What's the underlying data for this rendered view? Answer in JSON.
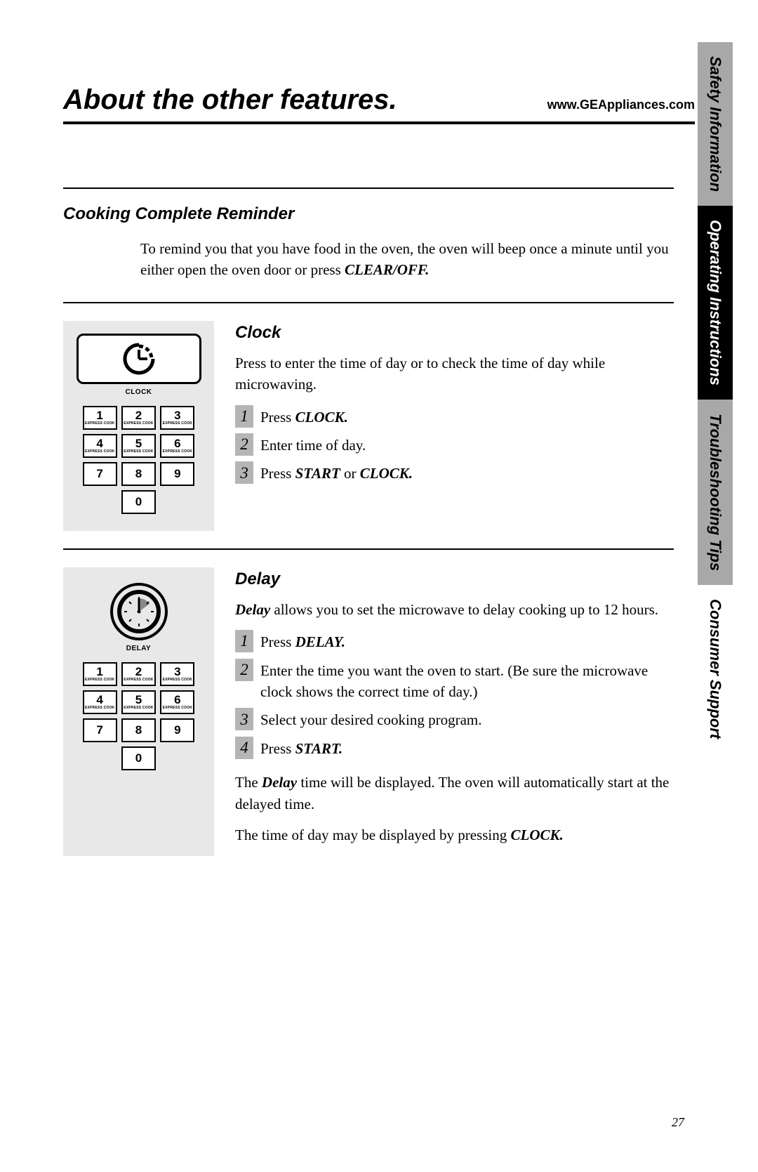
{
  "header": {
    "title": "About the other features.",
    "url": "www.GEAppliances.com"
  },
  "tabs": {
    "safety": "Safety Information",
    "operating": "Operating Instructions",
    "troubleshooting": "Troubleshooting Tips",
    "consumer": "Consumer Support"
  },
  "reminder": {
    "label": "Cooking Complete Reminder",
    "text_before": "To remind you that you have food in the oven, the oven will beep once a minute until you either open the oven door or press ",
    "text_bold": "CLEAR/OFF."
  },
  "keypad": {
    "express": "EXPRESS COOK",
    "keys": [
      "1",
      "2",
      "3",
      "4",
      "5",
      "6",
      "7",
      "8",
      "9",
      "0"
    ]
  },
  "clock": {
    "panel_label": "CLOCK",
    "label": "Clock",
    "intro": "Press to enter the time of day or to check the time of day while microwaving.",
    "steps": [
      {
        "pre": "Press ",
        "bold": "CLOCK."
      },
      {
        "pre": "Enter time of day."
      },
      {
        "pre": "Press ",
        "bold": "START",
        "mid": " or ",
        "bold2": "CLOCK."
      }
    ]
  },
  "delay": {
    "panel_label": "DELAY",
    "label": "Delay",
    "intro_bold": "Delay",
    "intro_rest": " allows you to set the microwave to delay cooking up to 12 hours.",
    "steps": [
      {
        "pre": "Press ",
        "bold": "DELAY."
      },
      {
        "pre": "Enter the time you want the oven to start. (Be sure the microwave clock shows the correct time of day.)"
      },
      {
        "pre": "Select your desired cooking program."
      },
      {
        "pre": "Press ",
        "bold": "START."
      }
    ],
    "after1_pre": "The ",
    "after1_bold": "Delay",
    "after1_rest": " time will be displayed. The oven will automatically start at the delayed time.",
    "after2_pre": "The time of day may be displayed by pressing ",
    "after2_bold": "CLOCK."
  },
  "page_number": "27",
  "step_nums": [
    "1",
    "2",
    "3",
    "4"
  ]
}
